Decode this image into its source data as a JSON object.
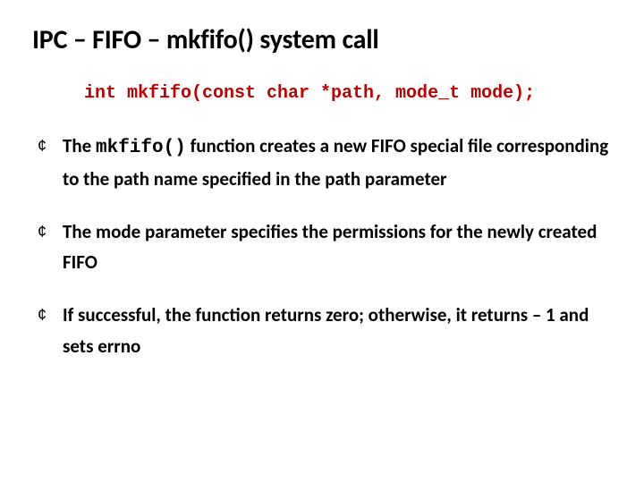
{
  "title_prefix": "IPC – FIFO – ",
  "title_func": "mkfifo()",
  "title_suffix": " system call",
  "signature": "int mkfifo(const char *path, mode_t mode);",
  "bullets": {
    "b1_pre": "The ",
    "b1_code": "mkfifo()",
    "b1_post": " function creates a new FIFO special file corresponding to the path name specified in the path parameter",
    "b2": "The mode parameter specifies the permissions for the newly created FIFO",
    "b3": "If successful, the function returns zero; otherwise, it returns – 1 and sets errno"
  }
}
